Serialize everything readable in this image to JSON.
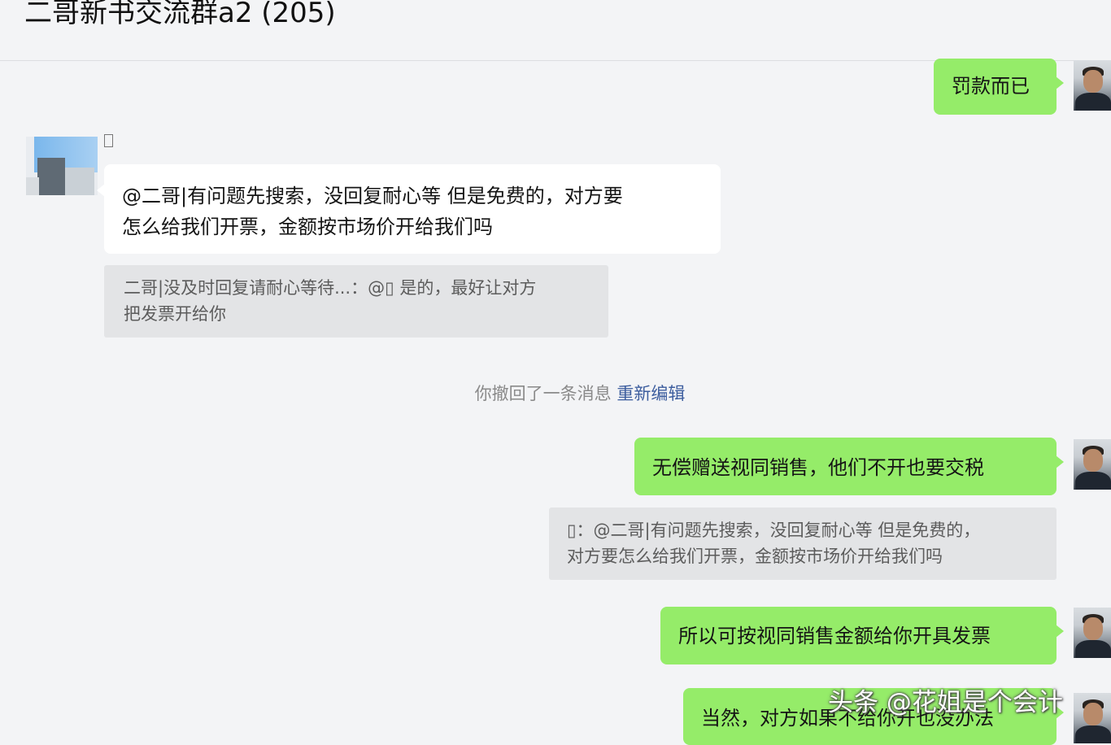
{
  "header": {
    "title": "二哥新书交流群a2 (205)"
  },
  "messages": {
    "m1": "罚款而已",
    "m2_line1": "@二哥|有问题先搜索，没回复耐心等 但是免费的，对方要",
    "m2_line2": "怎么给我们开票，金额按市场价开给我们吗",
    "q1_line1": "二哥|没及时回复请耐心等待...：@▯ 是的，最好让对方",
    "q1_line2": "把发票开给你",
    "system_text": "你撤回了一条消息",
    "system_link": "重新编辑",
    "m3": "无偿赠送视同销售，他们不开也要交税",
    "q2_line1": "▯：@二哥|有问题先搜索，没回复耐心等 但是免费的，",
    "q2_line2": "对方要怎么给我们开票，金额按市场价开给我们吗",
    "m4": "所以可按视同销售金额给你开具发票",
    "m5": "当然，对方如果不给你开也没办法"
  },
  "watermark": "头条 @花姐是个会计",
  "colors": {
    "my_bubble": "#95ec69",
    "other_bubble": "#ffffff",
    "quote_bg": "#e3e4e6",
    "link": "#3c5d9e",
    "background": "#f3f4f6"
  }
}
